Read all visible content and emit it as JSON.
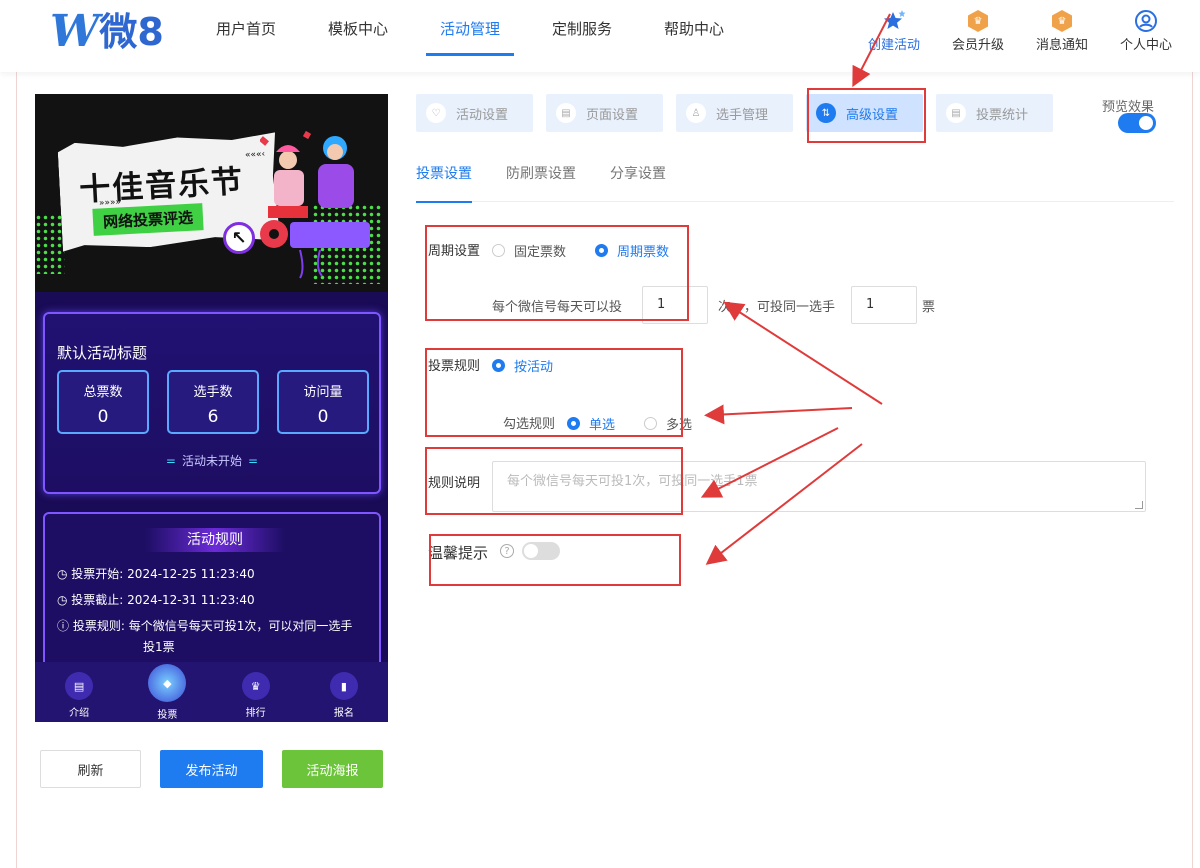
{
  "header": {
    "logo_mark": "W",
    "logo_text": "微8",
    "nav": [
      {
        "label": "用户首页",
        "active": false
      },
      {
        "label": "模板中心",
        "active": false
      },
      {
        "label": "活动管理",
        "active": true
      },
      {
        "label": "定制服务",
        "active": false
      },
      {
        "label": "帮助中心",
        "active": false
      }
    ],
    "actions": [
      {
        "label": "创建活动",
        "icon": "star-icon"
      },
      {
        "label": "会员升级",
        "icon": "crown-badge-icon"
      },
      {
        "label": "消息通知",
        "icon": "bell-badge-icon"
      },
      {
        "label": "个人中心",
        "icon": "user-icon"
      }
    ]
  },
  "preview": {
    "banner_title": "十佳音乐节",
    "banner_subtitle": "网络投票评选",
    "banner_small": "«««‹",
    "banner_small2": "»»»»",
    "activity_title": "默认活动标题",
    "stats": [
      {
        "label": "总票数",
        "value": "0"
      },
      {
        "label": "选手数",
        "value": "6"
      },
      {
        "label": "访问量",
        "value": "0"
      }
    ],
    "status": "活动未开始",
    "rules_title": "活动规则",
    "rules": [
      {
        "key": "◷ 投票开始:",
        "value": "2024-12-25 11:23:40"
      },
      {
        "key": "◷ 投票截止:",
        "value": "2024-12-31 11:23:40"
      },
      {
        "key": "ⓘ 投票规则:",
        "value": "每个微信号每天可投1次，可以对同一选手",
        "value2": "投1票"
      }
    ],
    "bottom_nav": [
      {
        "label": "介绍",
        "icon": "intro-icon"
      },
      {
        "label": "投票",
        "icon": "vote-icon"
      },
      {
        "label": "排行",
        "icon": "rank-icon"
      },
      {
        "label": "报名",
        "icon": "signup-icon"
      }
    ]
  },
  "buttons": {
    "refresh": "刷新",
    "publish": "发布活动",
    "poster": "活动海报"
  },
  "settings": {
    "tabs": [
      {
        "label": "活动设置",
        "icon": "heart-icon"
      },
      {
        "label": "页面设置",
        "icon": "page-icon"
      },
      {
        "label": "选手管理",
        "icon": "person-icon"
      },
      {
        "label": "高级设置",
        "icon": "sliders-icon"
      },
      {
        "label": "投票统计",
        "icon": "stats-icon"
      }
    ],
    "preview_label": "预览效果",
    "subtabs": [
      "投票设置",
      "防刷票设置",
      "分享设置"
    ],
    "period_label": "周期设置",
    "period_options": [
      "固定票数",
      "周期票数"
    ],
    "per_day_label": "每个微信号每天可以投",
    "per_day_value": "1",
    "times_unit": "次",
    "same_player_label": "，可投同一选手",
    "same_player_value": "1",
    "votes_unit": "票",
    "vote_rule_label": "投票规则",
    "vote_rule_option": "按活动",
    "select_rule_label": "勾选规则",
    "select_options": [
      "单选",
      "多选"
    ],
    "rule_desc_label": "规则说明",
    "rule_desc_placeholder": "每个微信号每天可投1次，可投同一选手1票",
    "tip_label": "温馨提示",
    "help_glyph": "?"
  },
  "colors": {
    "accent": "#1e7bf0",
    "annotation": "#e03b3b",
    "poster_green": "#6cc43a",
    "preview_bg": "#1a0b56"
  }
}
